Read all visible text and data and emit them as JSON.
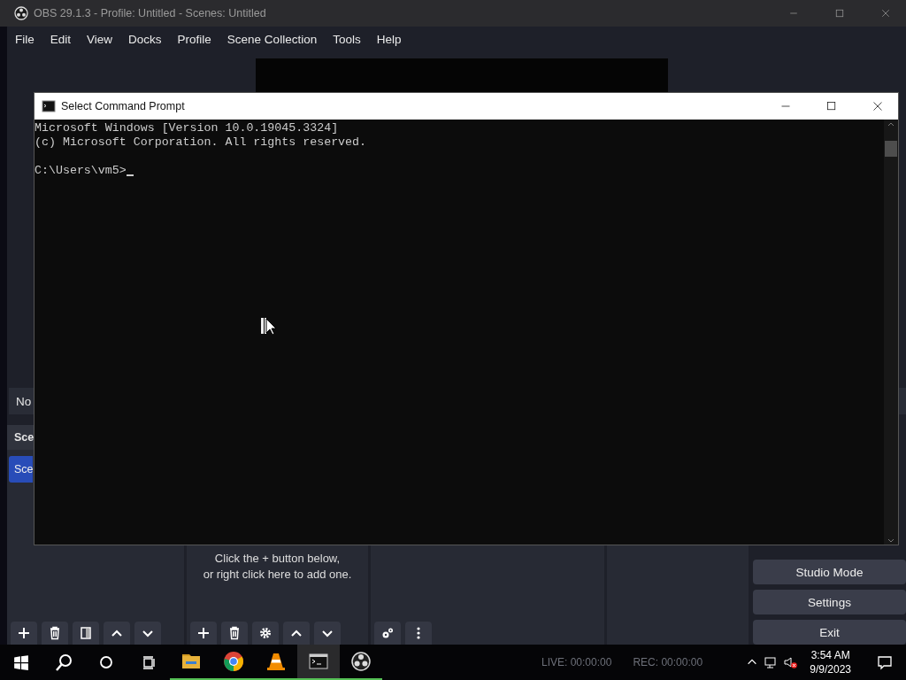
{
  "obs_window": {
    "title": "OBS 29.1.3 - Profile: Untitled - Scenes: Untitled",
    "menu": [
      "File",
      "Edit",
      "View",
      "Docks",
      "Profile",
      "Scene Collection",
      "Tools",
      "Help"
    ],
    "context_bar": {
      "label": "No"
    },
    "scenes_dock": {
      "title": "Sce",
      "scenes": [
        {
          "name": "Sce",
          "selected": true
        }
      ]
    },
    "sources_dock": {
      "hint_lines": [
        "Click the + button below,",
        "or right click here to add one."
      ]
    },
    "controls": [
      "Studio Mode",
      "Settings",
      "Exit"
    ]
  },
  "cmd_window": {
    "title": "Select Command Prompt",
    "lines": [
      "Microsoft Windows [Version 10.0.19045.3324]",
      "(c) Microsoft Corporation. All rights reserved."
    ],
    "prompt": "C:\\Users\\vm5>"
  },
  "taskbar": {
    "apps": [
      {
        "kind": "explorer",
        "active": false
      },
      {
        "kind": "chrome",
        "active": false
      },
      {
        "kind": "vlc",
        "active": false
      },
      {
        "kind": "terminal",
        "active": true
      },
      {
        "kind": "obs",
        "active": false
      }
    ],
    "status": [
      "LIVE: 00:00:00",
      "REC: 00:00:00"
    ],
    "time": "3:54 AM",
    "date": "9/9/2023"
  }
}
